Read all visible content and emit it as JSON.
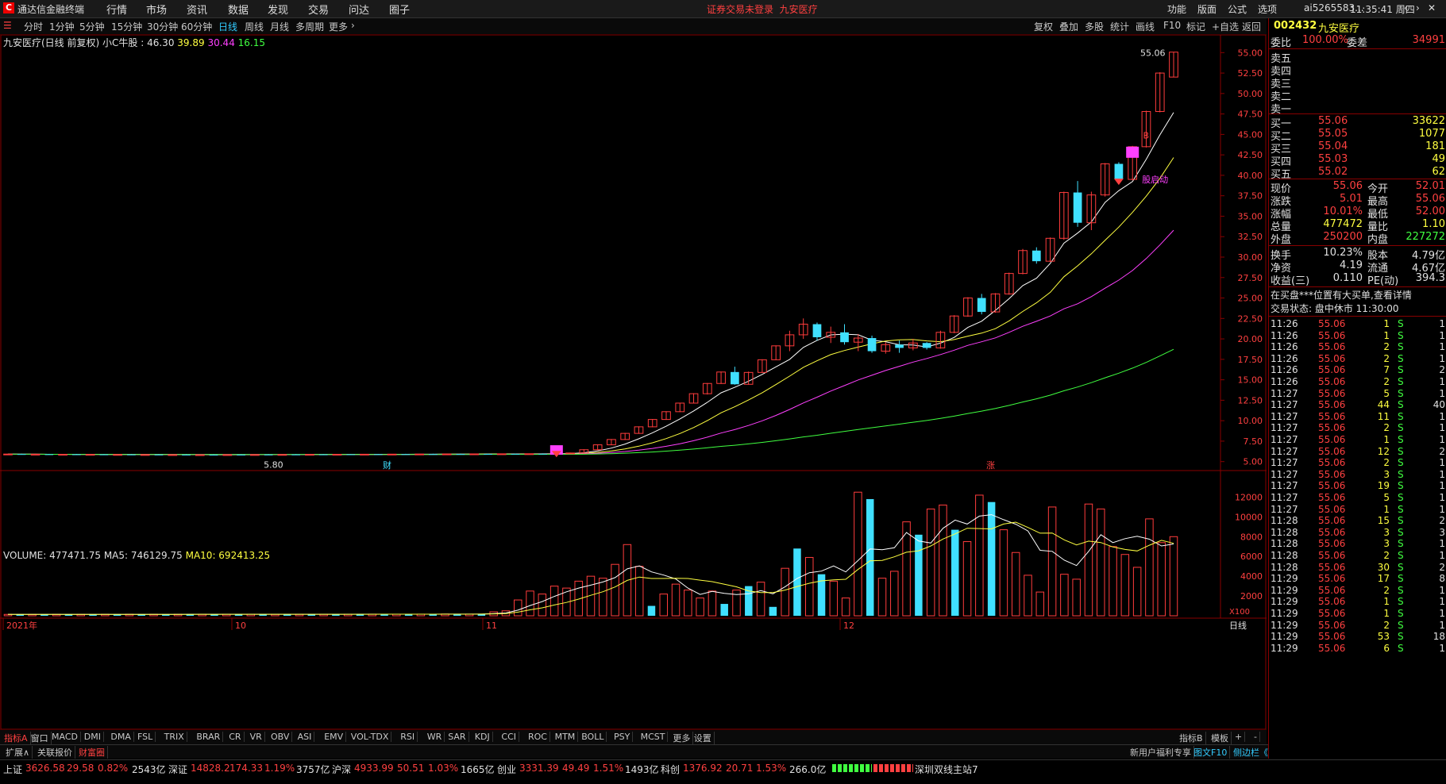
{
  "titlebar": {
    "logo": "C",
    "app_name": "通达信金融终端",
    "menus": [
      "行情",
      "市场",
      "资讯",
      "数据",
      "发现",
      "交易",
      "问达",
      "圈子"
    ],
    "notice_left": "证券交易未登录",
    "notice_right": "九安医疗",
    "right_items": [
      "功能",
      "版面",
      "公式",
      "选项"
    ],
    "user": "ai5265583...",
    "clock": "11:35:41 周四"
  },
  "periods": [
    "分时",
    "1分钟",
    "5分钟",
    "15分钟",
    "30分钟",
    "60分钟",
    "日线",
    "周线",
    "月线",
    "多周期",
    "更多"
  ],
  "active_period": "日线",
  "chart_tools": [
    "复权",
    "叠加",
    "多股",
    "统计",
    "画线",
    "F10",
    "标记",
    "+自选",
    "返回"
  ],
  "chart_header": {
    "name": "九安医疗(日线 前复权)",
    "indicator": "小C牛股 :",
    "v1": "46.30",
    "v2": "39.89",
    "v3": "30.44",
    "v4": "16.15"
  },
  "annotations": {
    "high_label": "55.06",
    "low_label": "5.80",
    "signal_label": "股启动",
    "marker_cai": "财",
    "marker_zhang": "涨",
    "marker_b": "B"
  },
  "price_axis": [
    "55.00",
    "52.50",
    "50.00",
    "47.50",
    "45.00",
    "42.50",
    "40.00",
    "37.50",
    "35.00",
    "32.50",
    "30.00",
    "27.50",
    "25.00",
    "22.50",
    "20.00",
    "17.50",
    "15.00",
    "12.50",
    "10.00",
    "7.50",
    "5.00"
  ],
  "vol_header": {
    "label": "VOLUME: 477471.75",
    "ma5": "MA5: 746129.75",
    "ma10": "MA10: 692413.25"
  },
  "vol_axis": [
    "12000",
    "10000",
    "8000",
    "6000",
    "4000",
    "2000"
  ],
  "vol_unit": "X100",
  "date_axis": {
    "year": "2021年",
    "m10": "10",
    "m11": "11",
    "m12": "12"
  },
  "day_line_label": "日线",
  "chart_data": {
    "type": "bar",
    "title": "九安医疗(日线 前复权)",
    "candles": [
      [
        5.9,
        5.95,
        5.85,
        5.92
      ],
      [
        5.92,
        5.96,
        5.86,
        5.88
      ],
      [
        5.88,
        5.93,
        5.84,
        5.9
      ],
      [
        5.9,
        5.95,
        5.86,
        5.87
      ],
      [
        5.87,
        5.92,
        5.83,
        5.89
      ],
      [
        5.89,
        5.94,
        5.85,
        5.86
      ],
      [
        5.86,
        5.91,
        5.82,
        5.88
      ],
      [
        5.88,
        5.92,
        5.84,
        5.85
      ],
      [
        5.85,
        5.9,
        5.81,
        5.87
      ],
      [
        5.87,
        5.91,
        5.83,
        5.84
      ],
      [
        5.84,
        5.89,
        5.8,
        5.86
      ],
      [
        5.86,
        5.9,
        5.82,
        5.83
      ],
      [
        5.83,
        5.88,
        5.8,
        5.85
      ],
      [
        5.85,
        5.89,
        5.81,
        5.82
      ],
      [
        5.82,
        5.87,
        5.8,
        5.84
      ],
      [
        5.84,
        5.88,
        5.81,
        5.83
      ],
      [
        5.83,
        5.87,
        5.8,
        5.85
      ],
      [
        5.85,
        5.89,
        5.82,
        5.84
      ],
      [
        5.84,
        5.88,
        5.81,
        5.86
      ],
      [
        5.86,
        5.9,
        5.83,
        5.85
      ],
      [
        5.85,
        5.89,
        5.82,
        5.87
      ],
      [
        5.87,
        5.91,
        5.84,
        5.86
      ],
      [
        5.86,
        5.9,
        5.83,
        5.88
      ],
      [
        5.88,
        5.92,
        5.85,
        5.87
      ],
      [
        5.87,
        5.91,
        5.84,
        5.89
      ],
      [
        5.89,
        5.93,
        5.86,
        5.88
      ],
      [
        5.88,
        5.92,
        5.85,
        5.9
      ],
      [
        5.9,
        5.94,
        5.87,
        5.89
      ],
      [
        5.89,
        5.93,
        5.86,
        5.91
      ],
      [
        5.91,
        5.95,
        5.88,
        5.9
      ],
      [
        5.9,
        5.94,
        5.87,
        5.92
      ],
      [
        5.92,
        5.96,
        5.89,
        5.91
      ],
      [
        5.91,
        5.95,
        5.88,
        5.93
      ],
      [
        5.93,
        5.97,
        5.9,
        5.92
      ],
      [
        5.92,
        5.96,
        5.89,
        5.94
      ],
      [
        5.94,
        5.98,
        5.91,
        5.93
      ],
      [
        5.93,
        5.97,
        5.9,
        5.95
      ],
      [
        5.95,
        5.99,
        5.92,
        5.94
      ],
      [
        5.94,
        5.98,
        5.91,
        5.96
      ],
      [
        5.96,
        6.0,
        5.93,
        5.95
      ],
      [
        5.95,
        6.05,
        5.92,
        6.0
      ],
      [
        6.0,
        6.1,
        5.96,
        6.05
      ],
      [
        6.05,
        6.5,
        6.0,
        6.45
      ],
      [
        6.45,
        7.1,
        6.4,
        7.05
      ],
      [
        7.05,
        7.75,
        7.0,
        7.7
      ],
      [
        7.7,
        8.5,
        7.65,
        8.45
      ],
      [
        8.45,
        9.3,
        8.4,
        9.25
      ],
      [
        9.25,
        10.2,
        9.2,
        10.15
      ],
      [
        10.15,
        11.15,
        10.1,
        11.1
      ],
      [
        11.1,
        12.2,
        11.05,
        12.15
      ],
      [
        12.15,
        13.35,
        12.1,
        13.3
      ],
      [
        13.3,
        14.6,
        13.2,
        14.55
      ],
      [
        14.55,
        16.0,
        14.5,
        15.95
      ],
      [
        15.95,
        16.6,
        14.4,
        14.45
      ],
      [
        14.45,
        16.0,
        14.4,
        15.9
      ],
      [
        15.9,
        17.5,
        15.85,
        17.45
      ],
      [
        17.45,
        19.2,
        17.4,
        19.15
      ],
      [
        19.15,
        21.0,
        18.5,
        20.5
      ],
      [
        20.5,
        22.5,
        20.0,
        21.8
      ],
      [
        21.8,
        22.0,
        19.8,
        20.2
      ],
      [
        20.2,
        21.5,
        19.5,
        20.8
      ],
      [
        20.8,
        21.8,
        19.3,
        19.6
      ],
      [
        19.6,
        20.6,
        18.5,
        20.1
      ],
      [
        20.1,
        20.4,
        18.3,
        18.5
      ],
      [
        18.5,
        19.6,
        18.2,
        19.3
      ],
      [
        19.3,
        19.8,
        18.3,
        18.9
      ],
      [
        18.9,
        20.0,
        18.6,
        19.5
      ],
      [
        19.5,
        19.6,
        18.7,
        18.9
      ],
      [
        18.9,
        21.0,
        18.8,
        20.8
      ],
      [
        20.8,
        22.9,
        20.7,
        22.8
      ],
      [
        22.8,
        25.1,
        22.7,
        25.0
      ],
      [
        25.0,
        25.5,
        23.0,
        23.3
      ],
      [
        23.3,
        25.6,
        23.2,
        25.5
      ],
      [
        25.5,
        28.1,
        25.4,
        28.0
      ],
      [
        28.0,
        31.0,
        27.9,
        30.8
      ],
      [
        30.8,
        31.2,
        29.2,
        29.5
      ],
      [
        29.5,
        32.4,
        29.4,
        32.3
      ],
      [
        32.3,
        38.0,
        32.1,
        37.9
      ],
      [
        37.9,
        39.3,
        33.7,
        34.2
      ],
      [
        34.2,
        38.0,
        33.3,
        37.6
      ],
      [
        37.6,
        41.5,
        37.4,
        41.4
      ],
      [
        41.4,
        41.6,
        39.2,
        39.5
      ],
      [
        39.5,
        43.6,
        39.4,
        43.5
      ],
      [
        43.5,
        47.9,
        43.4,
        47.8
      ],
      [
        47.8,
        52.6,
        47.7,
        52.5
      ],
      [
        52.01,
        55.06,
        52.0,
        55.06
      ]
    ],
    "volume": [
      140,
      150,
      130,
      160,
      140,
      150,
      135,
      145,
      150,
      140,
      155,
      140,
      150,
      145,
      150,
      160,
      150,
      140,
      155,
      150,
      160,
      150,
      145,
      160,
      150,
      165,
      155,
      150,
      160,
      155,
      165,
      160,
      155,
      170,
      165,
      160,
      175,
      170,
      165,
      170,
      400,
      500,
      1600,
      2500,
      2200,
      3000,
      2800,
      3500,
      4000,
      3800,
      5200,
      7200,
      5000,
      1000,
      2200,
      3200,
      2600,
      1800,
      2500,
      1200,
      2600,
      3000,
      3400,
      900,
      4800,
      6800,
      5900,
      4200,
      3500,
      1800,
      12500,
      11800,
      3800,
      4500,
      9500,
      8200,
      10800,
      11200,
      8700,
      7500,
      12200,
      11500,
      8700,
      6400,
      4100,
      2400,
      11000,
      4200,
      3700,
      11300,
      10800,
      7000,
      6200,
      4900,
      9800,
      7400,
      8000
    ],
    "volume_colors": "mixed",
    "ylim": [
      4.0,
      56.0
    ],
    "vol_ylim": [
      0,
      13000
    ]
  },
  "indicators": [
    "指标A",
    "窗口",
    "MACD",
    "DMI",
    "DMA",
    "FSL",
    "TRIX",
    "BRAR",
    "CR",
    "VR",
    "OBV",
    "ASI",
    "EMV",
    "VOL-TDX",
    "RSI",
    "WR",
    "SAR",
    "KDJ",
    "CCI",
    "ROC",
    "MTM",
    "BOLL",
    "PSY",
    "MCST",
    "更多",
    "设置"
  ],
  "ind_right": [
    "指标B",
    "模板",
    "+",
    "-"
  ],
  "ind2_left": [
    "扩展∧",
    "关联报价",
    "财富圈"
  ],
  "ind2_mid": "新用户福利专享",
  "ind2_right": [
    "图文F10",
    "侧边栏《"
  ],
  "ind2_tabs": [
    "笔",
    "价",
    "细",
    "势",
    "联",
    "值",
    "主"
  ],
  "watermark_url": "www.55188.com",
  "statusbar": {
    "sh_label": "上证",
    "sh_val": "3626.58",
    "sh_chg": "29.58",
    "sh_pct": "0.82%",
    "sh_amt": "2543亿",
    "sz_label": "深证",
    "sz_val": "14828.2",
    "sz_chg": "174.33",
    "sz_pct": "1.19%",
    "sz_amt": "3757亿",
    "hs_label": "沪深",
    "hs_val": "4933.99",
    "hs_chg": "50.51",
    "hs_pct": "1.03%",
    "hs_amt": "1665亿",
    "cy_label": "创业",
    "cy_val": "3331.39",
    "cy_chg": "49.49",
    "cy_pct": "1.51%",
    "cy_amt": "1493亿",
    "kc_label": "科创",
    "kc_val": "1376.92",
    "kc_chg": "20.71",
    "kc_pct": "1.53%",
    "kc_amt": "266.0亿",
    "server": "深圳双线主站7"
  },
  "quote": {
    "code": "002432",
    "name": "九安医疗",
    "weibi_label": "委比",
    "weibi": "100.00%",
    "weicha_label": "委差",
    "weicha": "34991",
    "sells": [
      {
        "label": "卖五"
      },
      {
        "label": "卖四"
      },
      {
        "label": "卖三"
      },
      {
        "label": "卖二"
      },
      {
        "label": "卖一"
      }
    ],
    "buys": [
      {
        "label": "买一",
        "price": "55.06",
        "vol": "33622"
      },
      {
        "label": "买二",
        "price": "55.05",
        "vol": "1077"
      },
      {
        "label": "买三",
        "price": "55.04",
        "vol": "181"
      },
      {
        "label": "买四",
        "price": "55.03",
        "vol": "49"
      },
      {
        "label": "买五",
        "price": "55.02",
        "vol": "62"
      }
    ],
    "stats": [
      {
        "l1": "现价",
        "v1": "55.06",
        "l2": "今开",
        "v2": "52.01"
      },
      {
        "l1": "涨跌",
        "v1": "5.01",
        "l2": "最高",
        "v2": "55.06"
      },
      {
        "l1": "涨幅",
        "v1": "10.01%",
        "l2": "最低",
        "v2": "52.00"
      },
      {
        "l1": "总量",
        "v1": "477472",
        "l2": "量比",
        "v2": "1.10"
      },
      {
        "l1": "外盘",
        "v1": "250200",
        "l2": "内盘",
        "v2": "227272"
      }
    ],
    "stats2": [
      {
        "l1": "换手",
        "v1": "10.23%",
        "l2": "股本",
        "v2": "4.79亿"
      },
      {
        "l1": "净资",
        "v1": "4.19",
        "l2": "流通",
        "v2": "4.67亿"
      },
      {
        "l1": "收益(三)",
        "v1": "0.110",
        "l2": "PE(动)",
        "v2": "394.3"
      }
    ],
    "msg": "在买盘***位置有大买单,查看详情",
    "trade_state": "交易状态: 盘中休市 11:30:00"
  },
  "ticks": [
    [
      "11:26",
      "55.06",
      "1",
      "S",
      "1"
    ],
    [
      "11:26",
      "55.06",
      "1",
      "S",
      "1"
    ],
    [
      "11:26",
      "55.06",
      "2",
      "S",
      "1"
    ],
    [
      "11:26",
      "55.06",
      "2",
      "S",
      "1"
    ],
    [
      "11:26",
      "55.06",
      "7",
      "S",
      "2"
    ],
    [
      "11:26",
      "55.06",
      "2",
      "S",
      "1"
    ],
    [
      "11:27",
      "55.06",
      "5",
      "S",
      "1"
    ],
    [
      "11:27",
      "55.06",
      "44",
      "S",
      "40"
    ],
    [
      "11:27",
      "55.06",
      "11",
      "S",
      "1"
    ],
    [
      "11:27",
      "55.06",
      "2",
      "S",
      "1"
    ],
    [
      "11:27",
      "55.06",
      "1",
      "S",
      "1"
    ],
    [
      "11:27",
      "55.06",
      "12",
      "S",
      "2"
    ],
    [
      "11:27",
      "55.06",
      "2",
      "S",
      "1"
    ],
    [
      "11:27",
      "55.06",
      "3",
      "S",
      "1"
    ],
    [
      "11:27",
      "55.06",
      "19",
      "S",
      "1"
    ],
    [
      "11:27",
      "55.06",
      "5",
      "S",
      "1"
    ],
    [
      "11:27",
      "55.06",
      "1",
      "S",
      "1"
    ],
    [
      "11:28",
      "55.06",
      "15",
      "S",
      "2"
    ],
    [
      "11:28",
      "55.06",
      "3",
      "S",
      "3"
    ],
    [
      "11:28",
      "55.06",
      "3",
      "S",
      "1"
    ],
    [
      "11:28",
      "55.06",
      "2",
      "S",
      "1"
    ],
    [
      "11:28",
      "55.06",
      "30",
      "S",
      "2"
    ],
    [
      "11:29",
      "55.06",
      "17",
      "S",
      "8"
    ],
    [
      "11:29",
      "55.06",
      "2",
      "S",
      "1"
    ],
    [
      "11:29",
      "55.06",
      "1",
      "S",
      "1"
    ],
    [
      "11:29",
      "55.06",
      "1",
      "S",
      "1"
    ],
    [
      "11:29",
      "55.06",
      "2",
      "S",
      "1"
    ],
    [
      "11:29",
      "55.06",
      "53",
      "S",
      "18"
    ],
    [
      "11:29",
      "55.06",
      "6",
      "S",
      "1"
    ]
  ]
}
